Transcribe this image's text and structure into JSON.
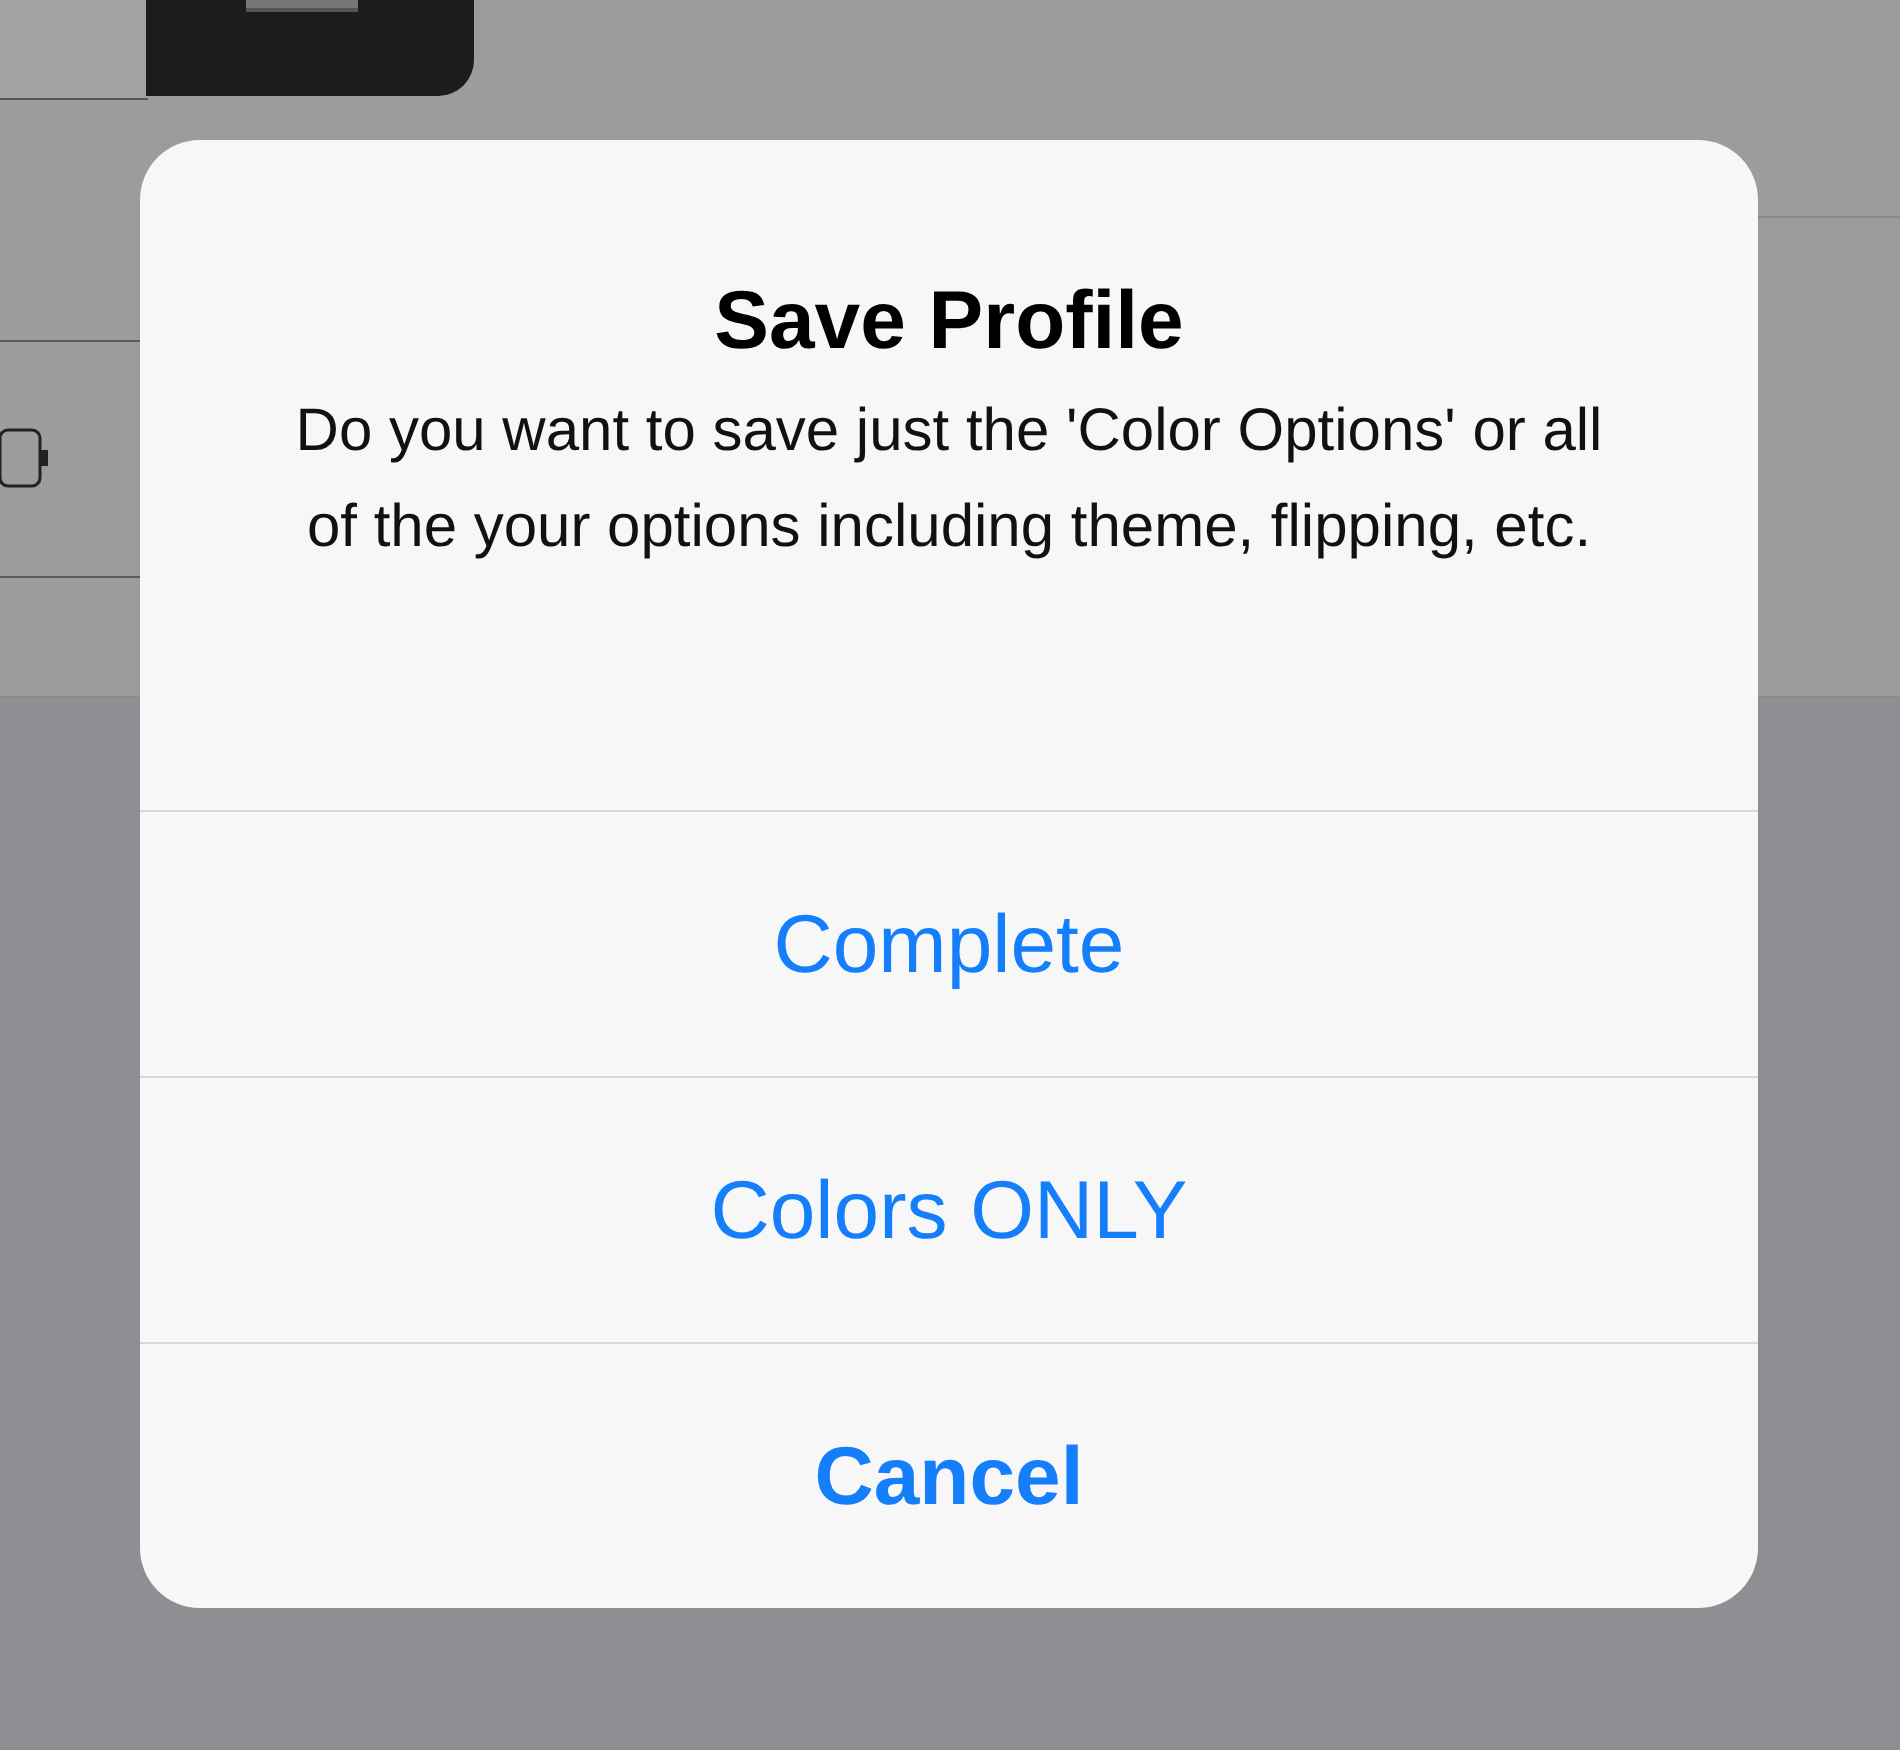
{
  "alert": {
    "title": "Save Profile",
    "message": "Do you want to save just the 'Color Options' or all of the your options including theme, flipping, etc.",
    "actions": [
      {
        "label": "Complete",
        "kind": "default"
      },
      {
        "label": "Colors ONLY",
        "kind": "default"
      },
      {
        "label": "Cancel",
        "kind": "cancel"
      }
    ]
  }
}
